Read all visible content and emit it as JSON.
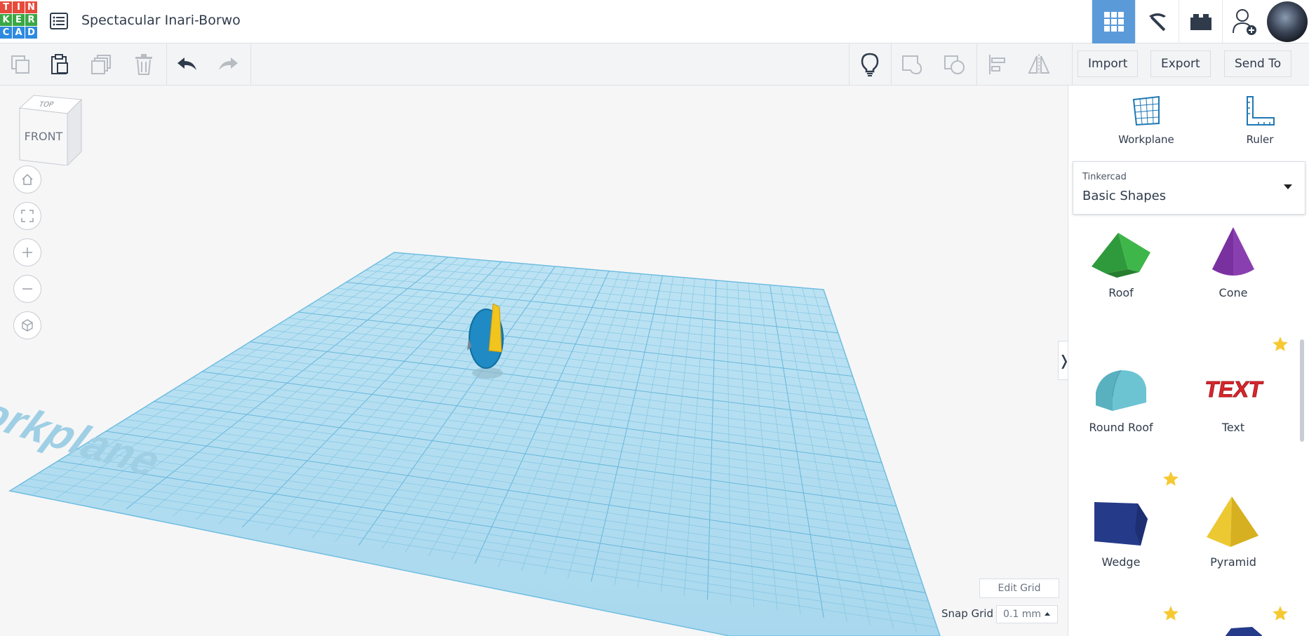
{
  "app": {
    "logo_letters": [
      "T",
      "I",
      "N",
      "K",
      "E",
      "R",
      "C",
      "A",
      "D"
    ],
    "logo_colors": [
      "#e64b3c",
      "#e64b3c",
      "#e64b3c",
      "#3aa745",
      "#3aa745",
      "#3aa745",
      "#2d8ae0",
      "#2d8ae0",
      "#2d8ae0"
    ],
    "title": "Spectacular Inari-Borwo"
  },
  "topnav": {
    "items": [
      {
        "name": "3d-design",
        "icon": "grid-icon",
        "active": true
      },
      {
        "name": "minecraft",
        "icon": "pickaxe-icon",
        "active": false
      },
      {
        "name": "lego",
        "icon": "brick-icon",
        "active": false
      },
      {
        "name": "invite",
        "icon": "add-user-icon",
        "active": false
      }
    ]
  },
  "toolbar": {
    "left_icons": [
      "copy-icon",
      "paste-icon",
      "duplicate-icon",
      "delete-icon",
      "undo-icon",
      "redo-icon"
    ],
    "right_icons": [
      "hint-icon",
      "group-icon",
      "ungroup-icon",
      "align-icon",
      "mirror-icon"
    ],
    "import_label": "Import",
    "export_label": "Export",
    "send_to_label": "Send To"
  },
  "viewcube": {
    "front": "FRONT",
    "top": "TOP"
  },
  "viewport": {
    "workplane_label": "Workplane",
    "edit_grid_label": "Edit Grid",
    "snap_grid_label": "Snap Grid",
    "snap_grid_value": "0.1 mm",
    "nav_controls": [
      "home-view-icon",
      "fit-view-icon",
      "zoom-in-icon",
      "zoom-out-icon",
      "ortho-view-icon"
    ]
  },
  "panel": {
    "workplane_label": "Workplane",
    "ruler_label": "Ruler",
    "library_category": "Tinkercad",
    "library_name": "Basic Shapes",
    "shapes": [
      {
        "label": "Roof",
        "color": "#3aa845",
        "starred": false
      },
      {
        "label": "Cone",
        "color": "#8a3fb0",
        "starred": false
      },
      {
        "label": "Round Roof",
        "color": "#6cc4d2",
        "starred": false
      },
      {
        "label": "Text",
        "color": "#d7262c",
        "starred": true
      },
      {
        "label": "Wedge",
        "color": "#263a8a",
        "starred": true
      },
      {
        "label": "Pyramid",
        "color": "#ecc832",
        "starred": false
      }
    ],
    "text_shape_glyphs": "TEXT"
  },
  "colors": {
    "accent": "#5b9ad9",
    "workplane": "#bfe3f3",
    "star": "#f6c933"
  }
}
